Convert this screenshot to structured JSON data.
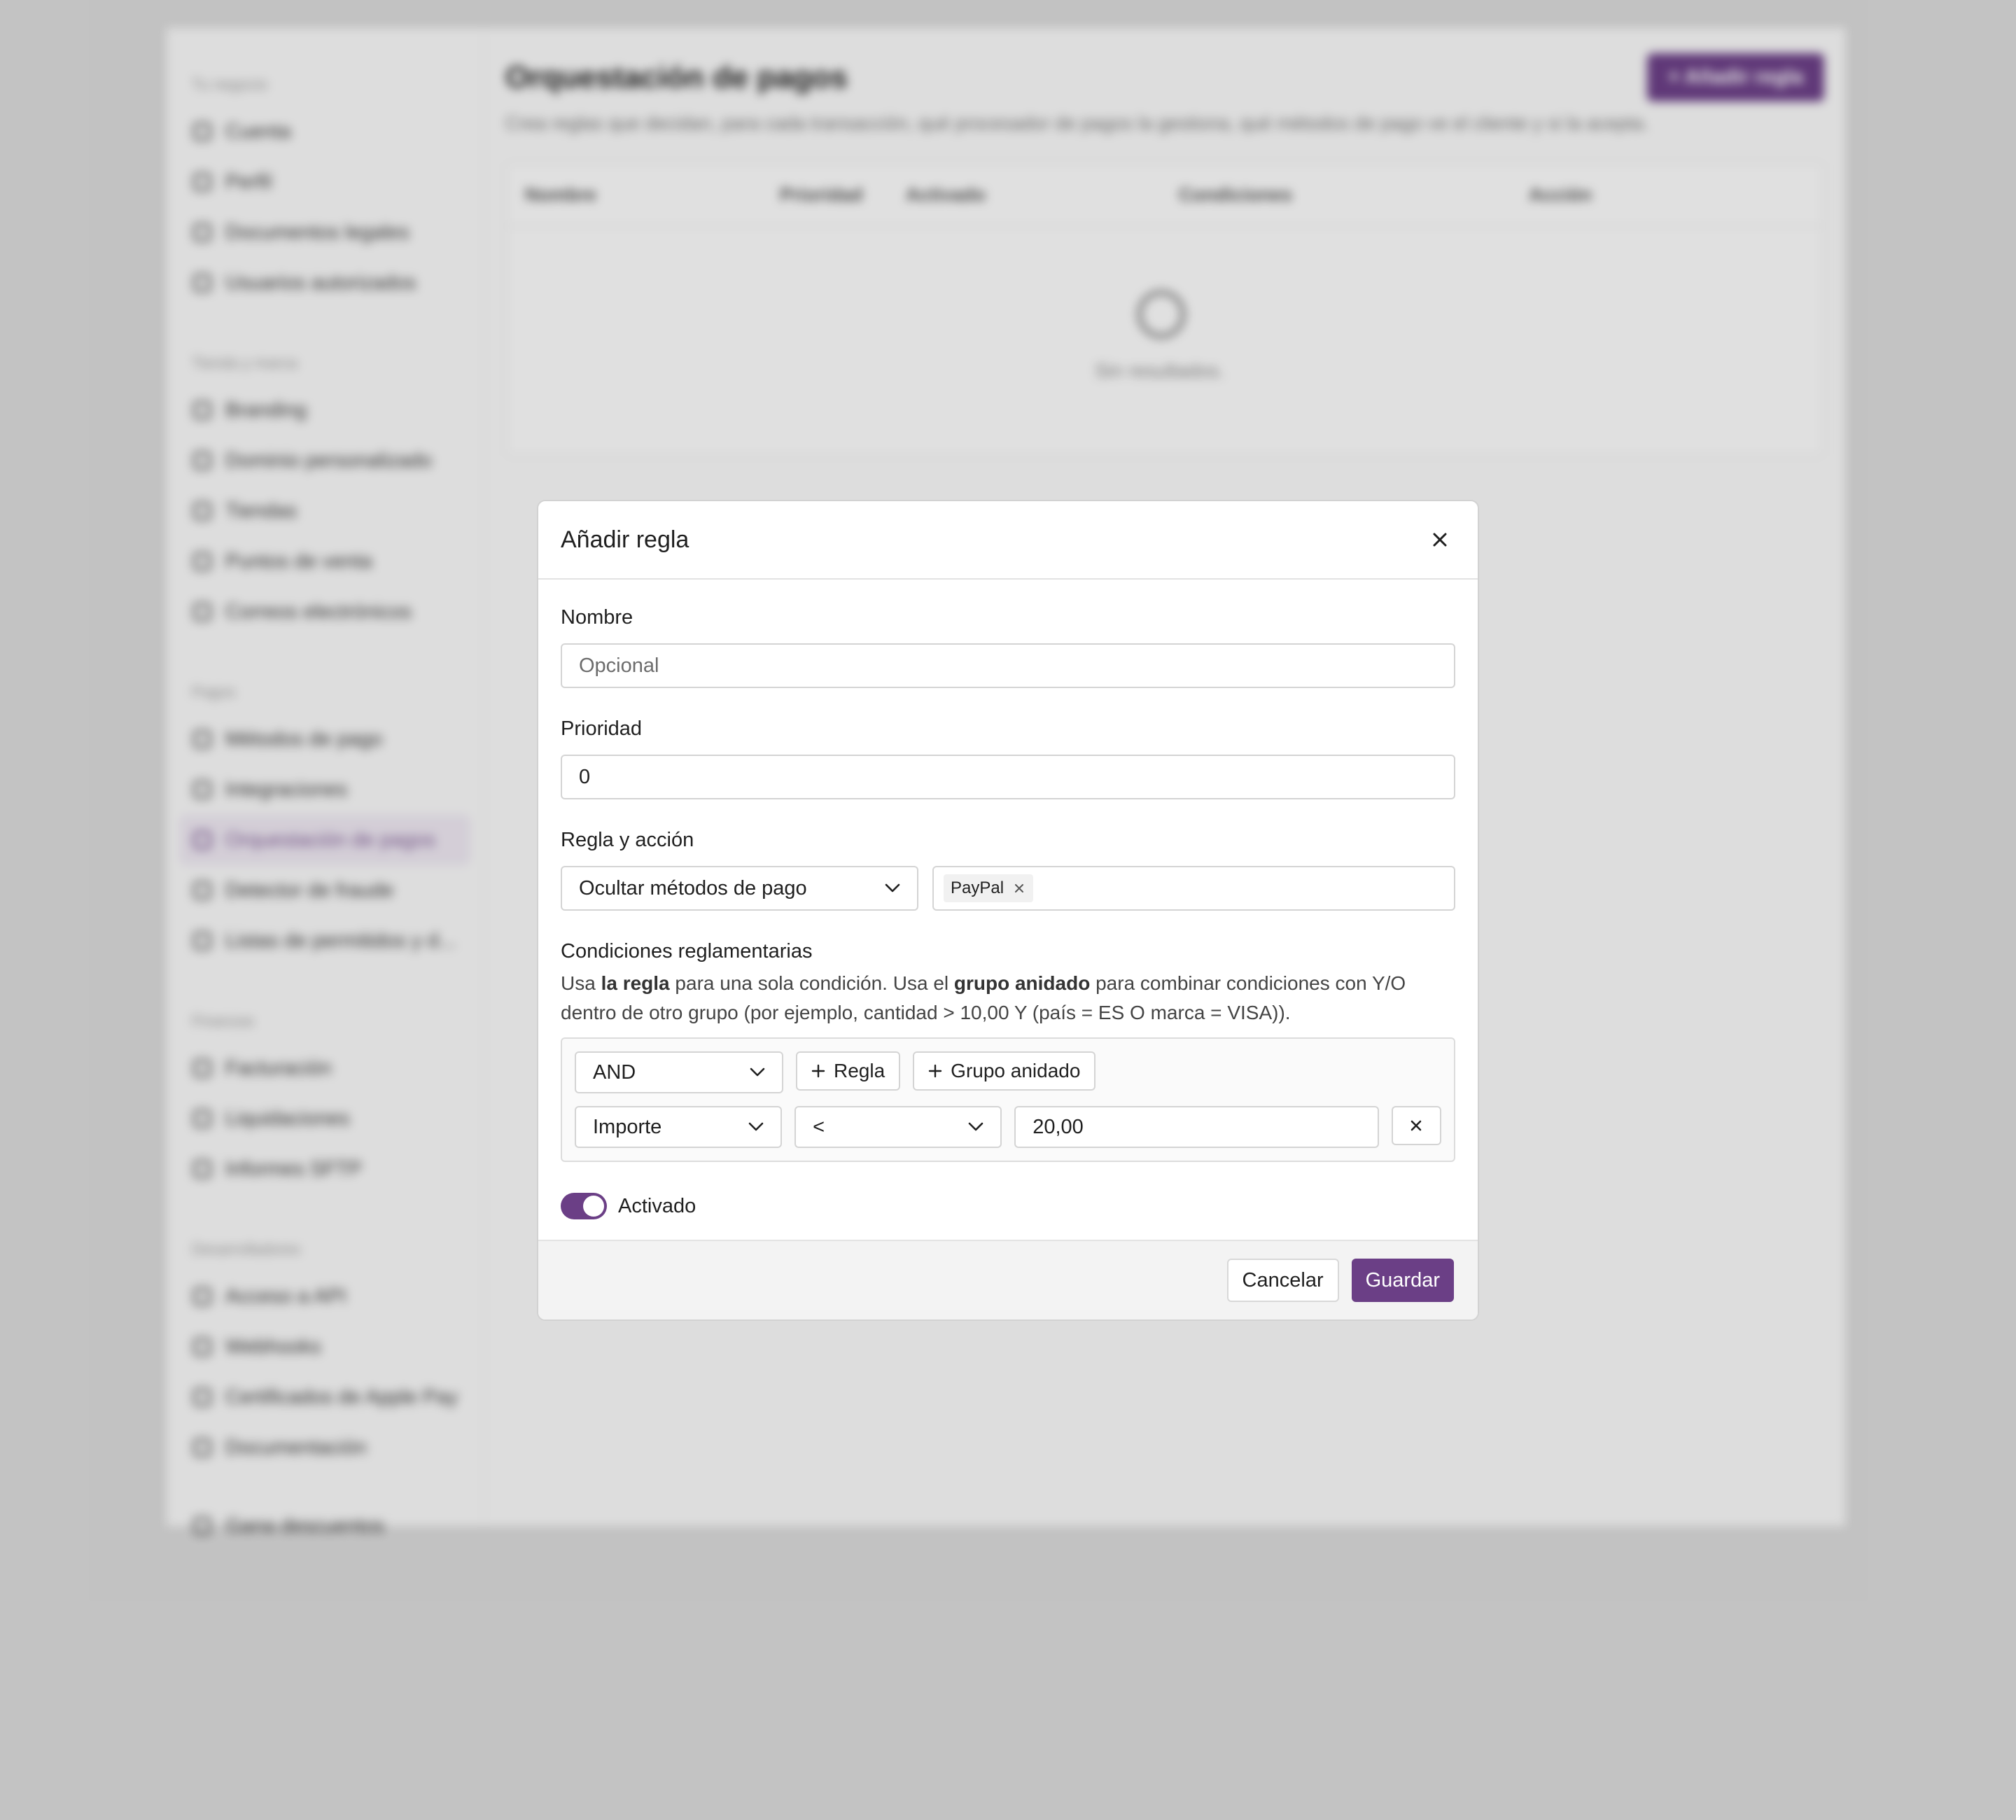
{
  "background": {
    "sidebar": {
      "sections": [
        {
          "title": "Tu negocio",
          "items": [
            "Cuenta",
            "Perfil",
            "Documentos legales",
            "Usuarios autorizados"
          ]
        },
        {
          "title": "Tienda y marca",
          "items": [
            "Branding",
            "Dominio personalizado",
            "Tiendas",
            "Puntos de venta",
            "Correos electrónicos"
          ]
        },
        {
          "title": "Pagos",
          "items": [
            "Métodos de pago",
            "Integraciones",
            "Orquestación de pagos",
            "Detector de fraude",
            "Listas de permitidos y d..."
          ]
        },
        {
          "title": "Finanzas",
          "items": [
            "Facturación",
            "Liquidaciones",
            "Informes SFTP"
          ]
        },
        {
          "title": "Desarrolladores",
          "items": [
            "Acceso a API",
            "Webhooks",
            "Certificados de Apple Pay",
            "Documentación"
          ]
        }
      ],
      "footer_item": "Gana descuentos",
      "active_item": "Orquestación de pagos"
    },
    "page_title": "Orquestación de pagos",
    "add_rule_button": "+ Añadir regla",
    "description": "Crea reglas que decidan, para cada transacción, qué procesador de pagos la gestiona, qué métodos de pago ve el cliente y si la acepta.",
    "table_headers": [
      "Nombre",
      "Prioridad",
      "Activado",
      "Condiciones",
      "Acción"
    ],
    "empty_text": "Sin resultados."
  },
  "modal": {
    "title": "Añadir regla",
    "name_label": "Nombre",
    "name_placeholder": "Opcional",
    "priority_label": "Prioridad",
    "priority_value": "0",
    "rule_action_label": "Regla y acción",
    "action_select": "Ocultar métodos de pago",
    "payment_chips": [
      "PayPal"
    ],
    "conditions_label": "Condiciones reglamentarias",
    "help": {
      "p1": "Usa ",
      "b1": "la regla",
      "p2": " para una sola condición. Usa el ",
      "b2": "grupo anidado",
      "p3": " para combinar condiciones con Y/O dentro de otro grupo (por ejemplo, cantidad > 10,00 Y (país = ES O marca = VISA))."
    },
    "logic_select": "AND",
    "add_rule_btn": "Regla",
    "add_group_btn": "Grupo anidado",
    "condition": {
      "field": "Importe",
      "operator": "<",
      "value": "20,00"
    },
    "enabled_label": "Activado",
    "enabled": true,
    "cancel_label": "Cancelar",
    "save_label": "Guardar"
  },
  "colors": {
    "accent": "#6b3f86",
    "backdrop": "#d9d9d9"
  }
}
